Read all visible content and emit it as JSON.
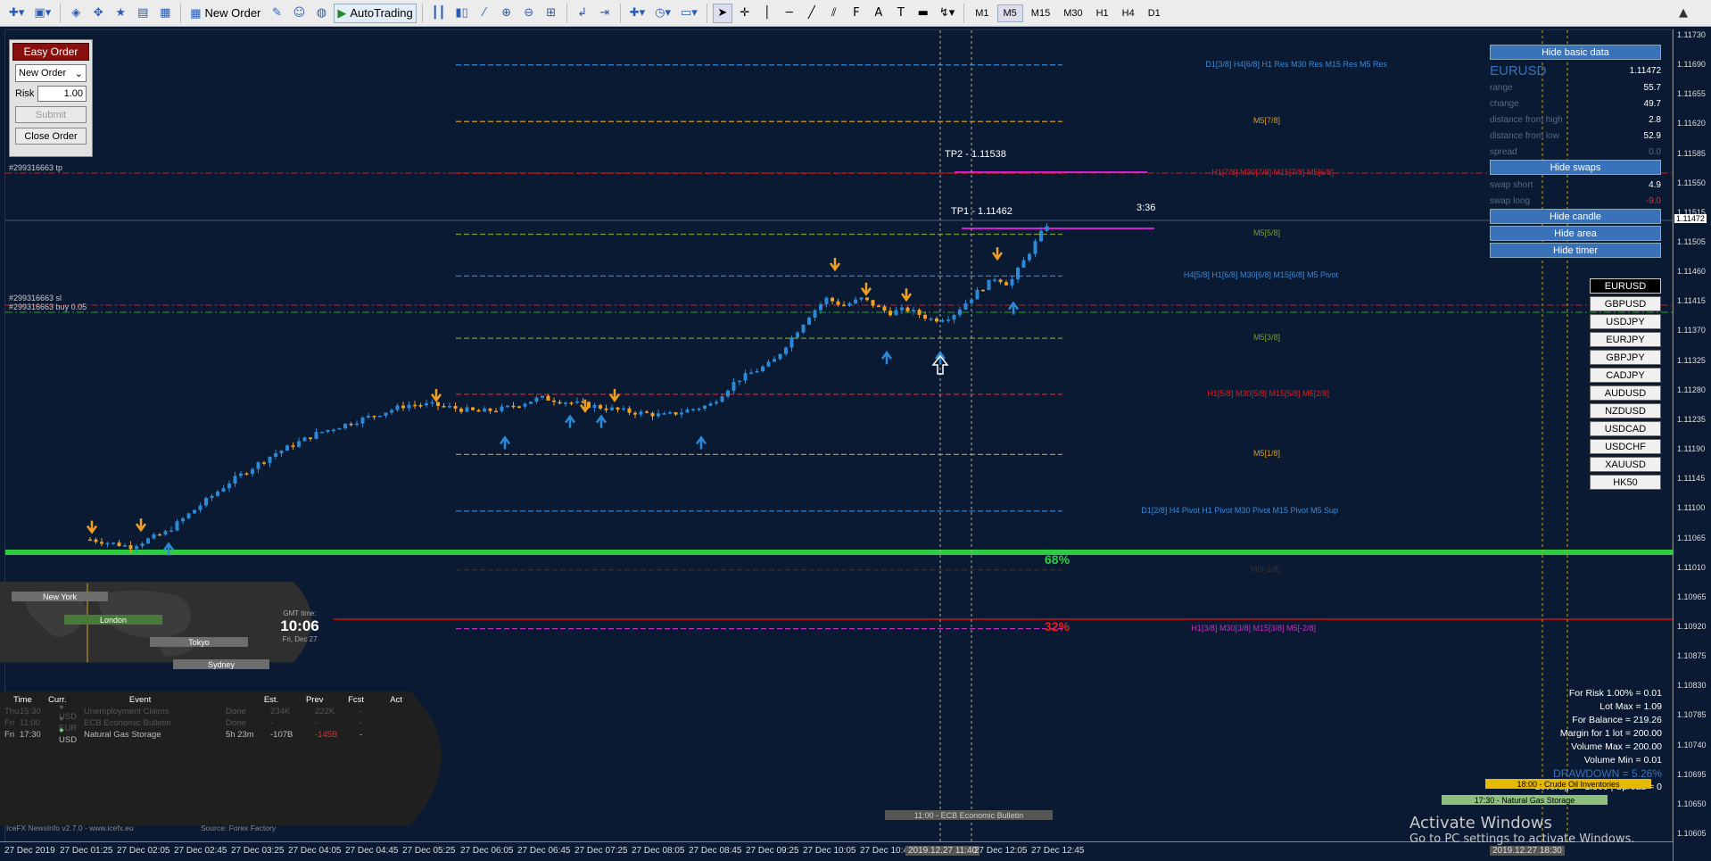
{
  "toolbar": {
    "new_order": "New Order",
    "autotrading": "AutoTrading",
    "timeframes": [
      "M1",
      "M5",
      "M15",
      "M30",
      "H1",
      "H4",
      "D1"
    ],
    "active_timeframe": "M5"
  },
  "easy_order": {
    "title": "Easy Order",
    "order_type": "New Order",
    "risk_label": "Risk",
    "risk_value": "1.00",
    "submit": "Submit",
    "close_order": "Close Order"
  },
  "chart": {
    "symbol": "EURUSD",
    "levels": [
      {
        "label": "D1[3/8] H4[6/8] H1 Res M30 Res M15 Res  M5 Res",
        "color": "#3a8ad6",
        "price": 1.1169
      },
      {
        "label": "M5[7/8]",
        "color": "#d49a20",
        "price": 1.1161
      },
      {
        "label": "H1[7/8] M30[7/8] M15[7/8]  M5[6/8]",
        "color": "#d82020",
        "price": 1.11537
      },
      {
        "label": "M5[5/8]",
        "color": "#7a9a2a",
        "price": 1.11451
      },
      {
        "label": "H4[5/8] H1[6/8] M30[6/8] M15[6/8]  M5 Pivot",
        "color": "#3a8ad6",
        "price": 1.11392
      },
      {
        "label": "M5[3/8]",
        "color": "#7a9a2a",
        "price": 1.11304
      },
      {
        "label": "H1[5/8] M30[5/8] M15[5/8]  M5[2/8]",
        "color": "#d82020",
        "price": 1.11225
      },
      {
        "label": "M5[1/8]",
        "color": "#d49a20",
        "price": 1.1114
      },
      {
        "label": "D1[2/8] H4 Pivot H1 Pivot M30 Pivot M15 Pivot  M5 Sup",
        "color": "#3a8ad6",
        "price": 1.1106
      },
      {
        "label": "M5[-1/8]",
        "color": "#333",
        "price": 1.10977
      },
      {
        "label": "H1[3/8] M30[3/8] M15[3/8]  M5[-2/8]",
        "color": "#c030c0",
        "price": 1.10894
      }
    ],
    "trade_labels": {
      "tp": "#299316663 tp",
      "sl": "#299316663 sl",
      "buy": "#299316663 buy 0.05"
    },
    "tp2": "TP2 - 1.11538",
    "tp1": "TP1 - 1.11462",
    "timer": "3:36",
    "pct_up": "68%",
    "pct_down": "32%",
    "y_ticks": [
      "1.11730",
      "1.11690",
      "1.11655",
      "1.11620",
      "1.11585",
      "1.11550",
      "1.11515",
      "1.11505",
      "1.11460",
      "1.11415",
      "1.11370",
      "1.11325",
      "1.11280",
      "1.11235",
      "1.11190",
      "1.11145",
      "1.11100",
      "1.11065",
      "1.11010",
      "1.10965",
      "1.10920",
      "1.10875",
      "1.10830",
      "1.10785",
      "1.10740",
      "1.10695",
      "1.10650",
      "1.10605"
    ],
    "current_price": "1.11472",
    "x_ticks": [
      "27 Dec 2019",
      "27 Dec 01:25",
      "27 Dec 02:05",
      "27 Dec 02:45",
      "27 Dec 03:25",
      "27 Dec 04:05",
      "27 Dec 04:45",
      "27 Dec 05:25",
      "27 Dec 06:05",
      "27 Dec 06:45",
      "27 Dec 07:25",
      "27 Dec 08:05",
      "27 Dec 08:45",
      "27 Dec 09:25",
      "27 Dec 10:05",
      "27 Dec 10:45",
      "2019.12.27 11:40",
      "27 Dec 12:05",
      "27 Dec 12:45"
    ],
    "x_cursor_label": "2019.12.27 18:30"
  },
  "info": {
    "hide_basic": "Hide basic data",
    "symbol": "EURUSD",
    "symbol_price": "1.11472",
    "rows": [
      {
        "k": "range",
        "v": "55.7"
      },
      {
        "k": "change",
        "v": "49.7"
      },
      {
        "k": "distance from high",
        "v": "2.8"
      },
      {
        "k": "distance from low",
        "v": "52.9"
      },
      {
        "k": "spread",
        "v": "0.0"
      }
    ],
    "hide_swaps": "Hide swaps",
    "swap_rows": [
      {
        "k": "swap short",
        "v": "4.9"
      },
      {
        "k": "swap long",
        "v": "-9.0"
      }
    ],
    "hide_candle": "Hide candle",
    "hide_area": "Hide area",
    "hide_timer": "Hide timer"
  },
  "pairs": [
    "EURUSD",
    "GBPUSD",
    "USDJPY",
    "EURJPY",
    "GBPJPY",
    "CADJPY",
    "AUDUSD",
    "NZDUSD",
    "USDCAD",
    "USDCHF",
    "XAUUSD",
    "HK50"
  ],
  "calc": [
    "For Risk 1.00% = 0.01",
    "Lot Max = 1.09",
    "For Balance = 219.26",
    "Margin for 1 lot = 200.00",
    "Volume Max = 200.00",
    "Volume Min = 0.01",
    "DRAWDOWN = 5.26%",
    "Leverage = 1:500 | Spread = 0"
  ],
  "news": {
    "cities": [
      "New York",
      "London",
      "Tokyo",
      "Sydney"
    ],
    "gmt_label": "GMT time:",
    "gmt_time": "10:06",
    "gmt_date": "Fri, Dec 27",
    "headers": [
      "Time",
      "Curr.",
      "Event",
      "Est.",
      "Prev",
      "Fcst",
      "Act"
    ],
    "events": [
      {
        "day": "Thu",
        "time": "15:30",
        "curr": "USD",
        "event": "Unemployment Claims",
        "est": "Done",
        "prev": "234K",
        "fcst": "222K",
        "act": "-"
      },
      {
        "day": "Fri",
        "time": "11:00",
        "curr": "EUR",
        "event": "ECB Economic Bulletin",
        "est": "Done",
        "prev": "-",
        "fcst": "-",
        "act": "-"
      },
      {
        "day": "Fri",
        "time": "17:30",
        "curr": "USD",
        "event": "Natural Gas Storage",
        "est": "5h 23m",
        "prev": "-107B",
        "fcst": "-145B",
        "act": "-"
      }
    ],
    "footer_left": "IceFX NewsInfo v2.7.0  -  www.icefx.eu",
    "footer_right": "Source: Forex Factory",
    "tag_ecb": "11:00 - ECB Economic Bulletin",
    "tag_crude": "18:00 - Crude Oil Inventories",
    "tag_gas": "17:30 - Natural Gas Storage"
  },
  "watermark": {
    "title": "Activate Windows",
    "sub": "Go to PC settings to activate Windows."
  }
}
